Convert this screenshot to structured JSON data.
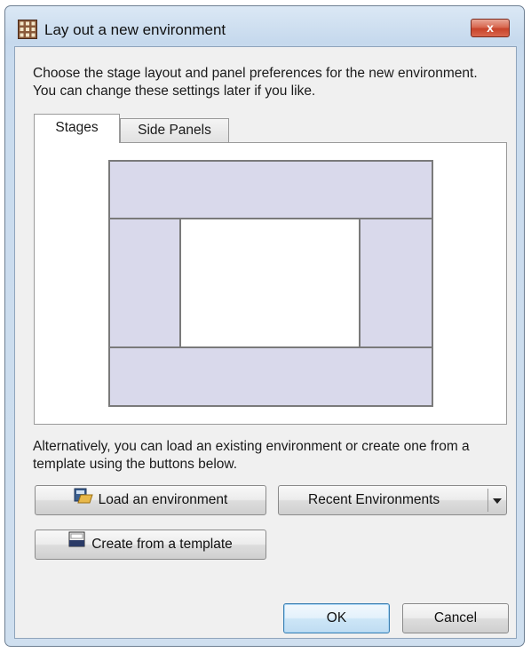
{
  "window": {
    "title": "Lay out a new environment",
    "close_glyph": "x",
    "icon": "grid-app-icon"
  },
  "intro_text": "Choose the stage layout and panel preferences for the new environment. You can change these settings later if you like.",
  "tabs": [
    {
      "label": "Stages",
      "selected": true
    },
    {
      "label": "Side Panels",
      "selected": false
    }
  ],
  "stage_layout": {
    "regions": [
      "top",
      "left",
      "center",
      "right",
      "bottom"
    ],
    "region_color": "#d9d9eb",
    "center_color": "#ffffff"
  },
  "alt_text": "Alternatively, you can load an existing environment or create one from a template using the buttons below.",
  "buttons": {
    "load": {
      "label": "Load an environment",
      "icon": "folder-open-icon"
    },
    "recent": {
      "label": "Recent Environments",
      "icon": "dropdown-arrow-icon"
    },
    "template": {
      "label": "Create from a template",
      "icon": "template-icon"
    },
    "ok": {
      "label": "OK"
    },
    "cancel": {
      "label": "Cancel"
    }
  }
}
